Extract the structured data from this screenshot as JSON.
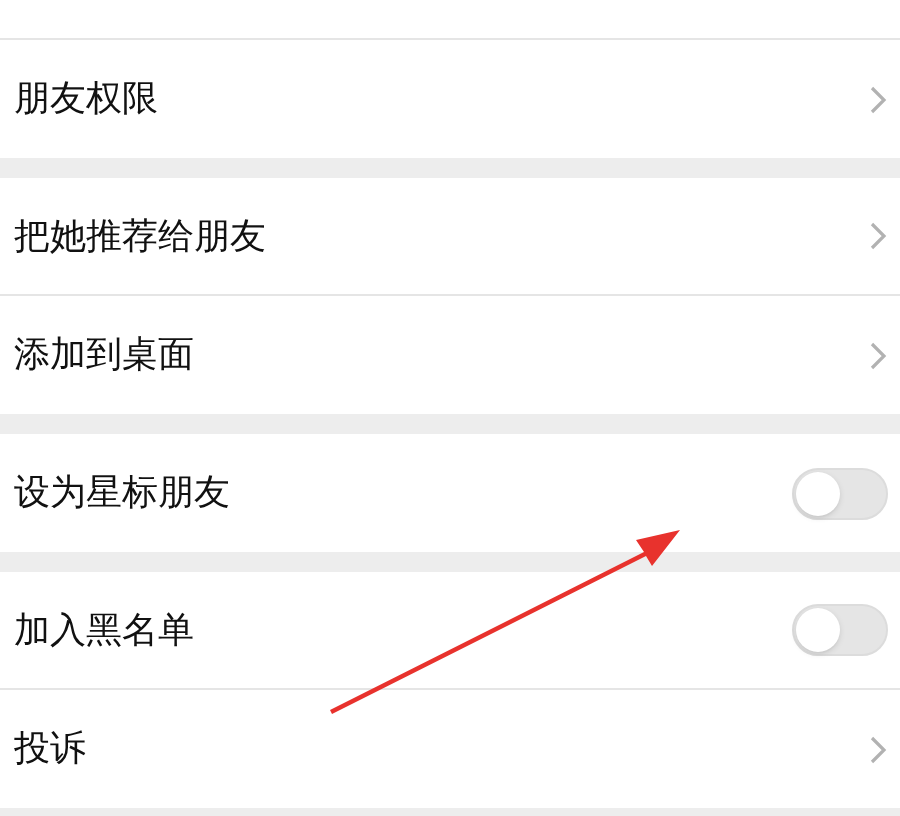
{
  "groups": [
    {
      "rows": [
        {
          "kind": "link",
          "label": "朋友权限"
        }
      ]
    },
    {
      "rows": [
        {
          "kind": "link",
          "label": "把她推荐给朋友"
        },
        {
          "kind": "link",
          "label": "添加到桌面"
        }
      ]
    },
    {
      "rows": [
        {
          "kind": "toggle",
          "label": "设为星标朋友",
          "on": false
        }
      ]
    },
    {
      "rows": [
        {
          "kind": "toggle",
          "label": "加入黑名单",
          "on": false
        },
        {
          "kind": "link",
          "label": "投诉"
        }
      ]
    }
  ]
}
